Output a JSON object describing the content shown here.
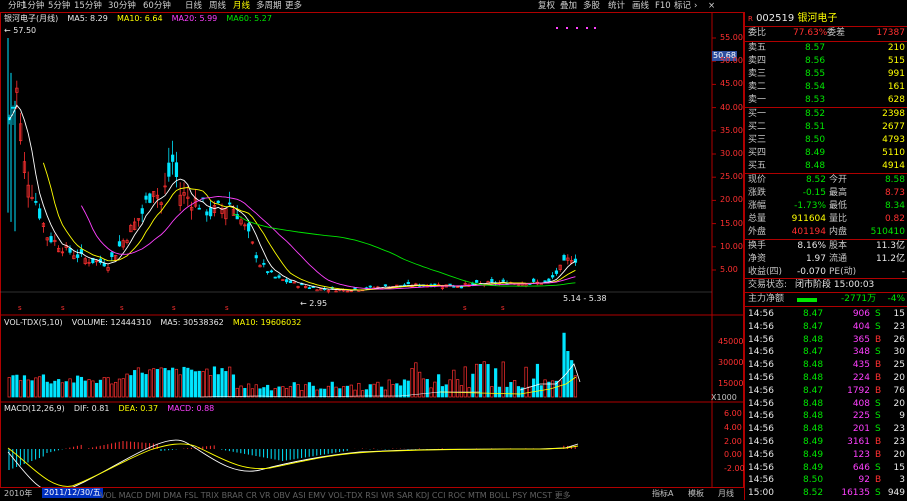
{
  "toolbar": {
    "periods": [
      "分时",
      "1分钟",
      "5分钟",
      "15分钟",
      "30分钟",
      "60分钟",
      "日线",
      "周线",
      "月线",
      "多周期",
      "更多"
    ],
    "active_period": "月线",
    "right_buttons": [
      "复权",
      "叠加",
      "多股",
      "统计",
      "画线",
      "F10",
      "标记"
    ],
    "more_arrow": "›",
    "close": "×"
  },
  "main_chart": {
    "title": "银河电子(月线)",
    "ma5_label": "MA5: 8.29",
    "ma10_label": "MA10: 6.64",
    "ma20_label": "MA20: 5.99",
    "ma60_label": "MA60: 5.27",
    "high_label": "← 57.50",
    "low_label": "← 2.95",
    "range_label": "5.14 - 5.38",
    "price_marker": "50.68",
    "price_axis": [
      "55.00",
      "50.00",
      "45.00",
      "40.00",
      "35.00",
      "30.00",
      "25.00",
      "20.00",
      "15.00",
      "10.00",
      "5.00"
    ]
  },
  "volume_chart": {
    "title": "VOL-TDX(5,10)",
    "volume_label": "VOLUME: 12444310",
    "ma5_label": "MA5: 30538362",
    "ma10_label": "MA10: 19606032",
    "axis": [
      "45000",
      "30000",
      "15000"
    ],
    "unit": "X1000"
  },
  "macd_chart": {
    "title": "MACD(12,26,9)",
    "dif_label": "DIF: 0.81",
    "dea_label": "DEA: 0.37",
    "macd_label": "MACD: 0.88",
    "axis": [
      "6.00",
      "4.00",
      "2.00",
      "0.00",
      "-2.00"
    ]
  },
  "bottom_bar": {
    "start_year": "2010年",
    "date_badge": "2011/12/30/五",
    "indicator_tabs": [
      "指标A",
      "模板",
      "月线"
    ],
    "tabs_partial": "VOL  MACD  DMI  DMA  FSL  TRIX  BRAR  CR  VR  OBV  ASI  EMV  VOL-TDX  RSI  WR  SAR  KDJ  CCI  ROC  MTM  BOLL  PSY  MCST  更多"
  },
  "quote": {
    "code": "002519",
    "name": "银河电子",
    "webi_label": "委比",
    "webi_value": "77.63%",
    "weicha_label": "委差",
    "weicha_value": "17387",
    "asks": [
      {
        "label": "卖五",
        "price": "8.57",
        "vol": "210"
      },
      {
        "label": "卖四",
        "price": "8.56",
        "vol": "515"
      },
      {
        "label": "卖三",
        "price": "8.55",
        "vol": "991"
      },
      {
        "label": "卖二",
        "price": "8.54",
        "vol": "161"
      },
      {
        "label": "卖一",
        "price": "8.53",
        "vol": "628"
      }
    ],
    "bids": [
      {
        "label": "买一",
        "price": "8.52",
        "vol": "2398"
      },
      {
        "label": "买二",
        "price": "8.51",
        "vol": "2677"
      },
      {
        "label": "买三",
        "price": "8.50",
        "vol": "4793"
      },
      {
        "label": "买四",
        "price": "8.49",
        "vol": "5110"
      },
      {
        "label": "买五",
        "price": "8.48",
        "vol": "4914"
      }
    ],
    "stats": [
      {
        "l1": "现价",
        "v1": "8.52",
        "l2": "今开",
        "v2": "8.58"
      },
      {
        "l1": "涨跌",
        "v1": "-0.15",
        "l2": "最高",
        "v2": "8.73"
      },
      {
        "l1": "涨幅",
        "v1": "-1.73%",
        "l2": "最低",
        "v2": "8.34"
      },
      {
        "l1": "总量",
        "v1": "911604",
        "l2": "量比",
        "v2": "0.82"
      },
      {
        "l1": "外盘",
        "v1": "401194",
        "l2": "内盘",
        "v2": "510410"
      }
    ],
    "stats2": [
      {
        "l1": "换手",
        "v1": "8.16%",
        "l2": "股本",
        "v2": "11.3亿"
      },
      {
        "l1": "净资",
        "v1": "1.97",
        "l2": "流通",
        "v2": "11.2亿"
      },
      {
        "l1": "收益(四)",
        "v1": "-0.070",
        "l2": "PE(动)",
        "v2": "-"
      }
    ],
    "status_label": "交易状态:",
    "status_value": "闭市阶段 15:00:03",
    "mainflow_label": "主力净额",
    "mainflow_value": "-2771万",
    "mainflow_pct": "-4%"
  },
  "ticks": [
    {
      "t": "14:56",
      "p": "8.47",
      "v": "906",
      "d": "S",
      "n": "15"
    },
    {
      "t": "14:56",
      "p": "8.47",
      "v": "404",
      "d": "S",
      "n": "23"
    },
    {
      "t": "14:56",
      "p": "8.48",
      "v": "365",
      "d": "B",
      "n": "26"
    },
    {
      "t": "14:56",
      "p": "8.47",
      "v": "348",
      "d": "S",
      "n": "30"
    },
    {
      "t": "14:56",
      "p": "8.48",
      "v": "435",
      "d": "B",
      "n": "25"
    },
    {
      "t": "14:56",
      "p": "8.48",
      "v": "224",
      "d": "B",
      "n": "20"
    },
    {
      "t": "14:56",
      "p": "8.47",
      "v": "1792",
      "d": "B",
      "n": "76"
    },
    {
      "t": "14:56",
      "p": "8.48",
      "v": "408",
      "d": "S",
      "n": "20"
    },
    {
      "t": "14:56",
      "p": "8.48",
      "v": "225",
      "d": "S",
      "n": "9"
    },
    {
      "t": "14:56",
      "p": "8.48",
      "v": "201",
      "d": "S",
      "n": "23"
    },
    {
      "t": "14:56",
      "p": "8.49",
      "v": "3161",
      "d": "B",
      "n": "23"
    },
    {
      "t": "14:56",
      "p": "8.49",
      "v": "123",
      "d": "B",
      "n": "20"
    },
    {
      "t": "14:56",
      "p": "8.49",
      "v": "646",
      "d": "S",
      "n": "15"
    },
    {
      "t": "14:56",
      "p": "8.50",
      "v": "92",
      "d": "B",
      "n": "3"
    },
    {
      "t": "15:00",
      "p": "8.52",
      "v": "16135",
      "d": "S",
      "n": "949"
    }
  ],
  "colors": {
    "up": "#ff3030",
    "down": "#00e5ff",
    "ma5": "#ffffff",
    "ma10": "#ffff00",
    "ma20": "#ff40ff",
    "ma60": "#00e600",
    "grid": "#b00000"
  }
}
